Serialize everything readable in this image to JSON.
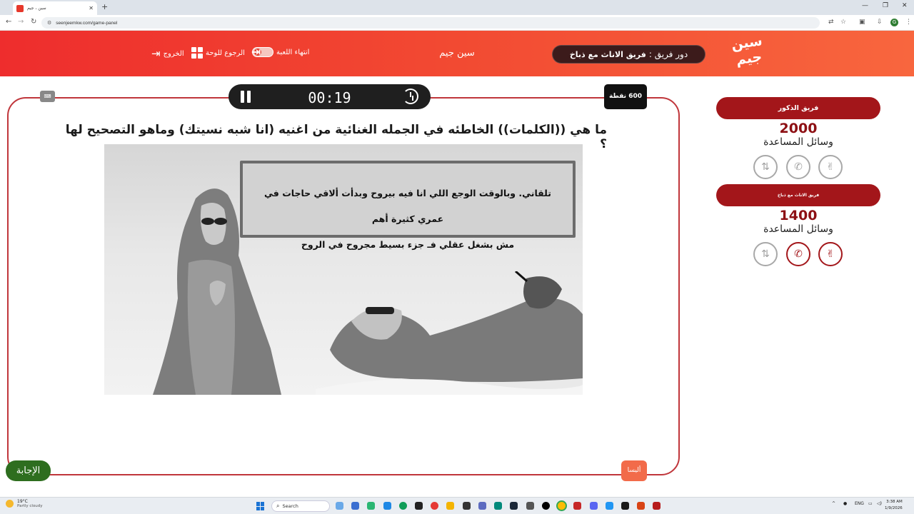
{
  "browser": {
    "tab_title": "سين ، جيم",
    "new_tab": "+",
    "url": "seenjeemkw.com/game-panel",
    "window_controls": [
      "—",
      "❐",
      "✕"
    ],
    "nav": [
      "←",
      "→",
      "↻"
    ],
    "profile_initial": "G"
  },
  "header": {
    "logo_text": "سين جيم",
    "turn_prefix": "دور فريق :",
    "turn_team": "فريق الاناث مع ذباخ",
    "site_name": "سين جيم",
    "end_game_label": "انتهاء اللعبة",
    "back_to_board_label": "الرجوع للوحة",
    "exit_label": "الخروج"
  },
  "game": {
    "timer": "00:19",
    "points_badge": "600 نقطة",
    "question": "ما هي ((الكلمات)) الخاطئه في الجمله الغنائية من اغنيه (انا شبه نسيتك) وماهو التصحيح لها ؟",
    "lyric_line1": "تلقاني. وبالوقت الوجع اللي انا فيه بيروح وبدأت ألاقي حاجات في عمري كثيرة أهم",
    "lyric_line2": "مش بشغل عقلي فـ جزء بسيط مجروح في الروح",
    "answer_label": "الإجابة",
    "next_label": "أليسا"
  },
  "teams": [
    {
      "name": "فريق الذكور",
      "score": "2000",
      "help_label": "وسائل المساعدة",
      "aids": [
        {
          "icon": "swap-icon",
          "used": true
        },
        {
          "icon": "phone-icon",
          "used": true
        },
        {
          "icon": "two-answers-icon",
          "used": true
        }
      ]
    },
    {
      "name": "فريق الاناث مع ذباخ",
      "score": "1400",
      "help_label": "وسائل المساعدة",
      "aids": [
        {
          "icon": "swap-icon",
          "used": true
        },
        {
          "icon": "phone-icon",
          "used": false
        },
        {
          "icon": "two-answers-icon",
          "used": false
        }
      ]
    }
  ],
  "taskbar": {
    "temperature": "19°C",
    "weather": "Partly cloudy",
    "search_label": "Search",
    "lang": "ENG",
    "time": "3:38 AM",
    "date": "1/9/2026"
  },
  "colors": {
    "header_red": "#ee2d2d",
    "team_bar": "#a3161a",
    "answer_green": "#2e6e1f",
    "board_border": "#c0363b"
  }
}
